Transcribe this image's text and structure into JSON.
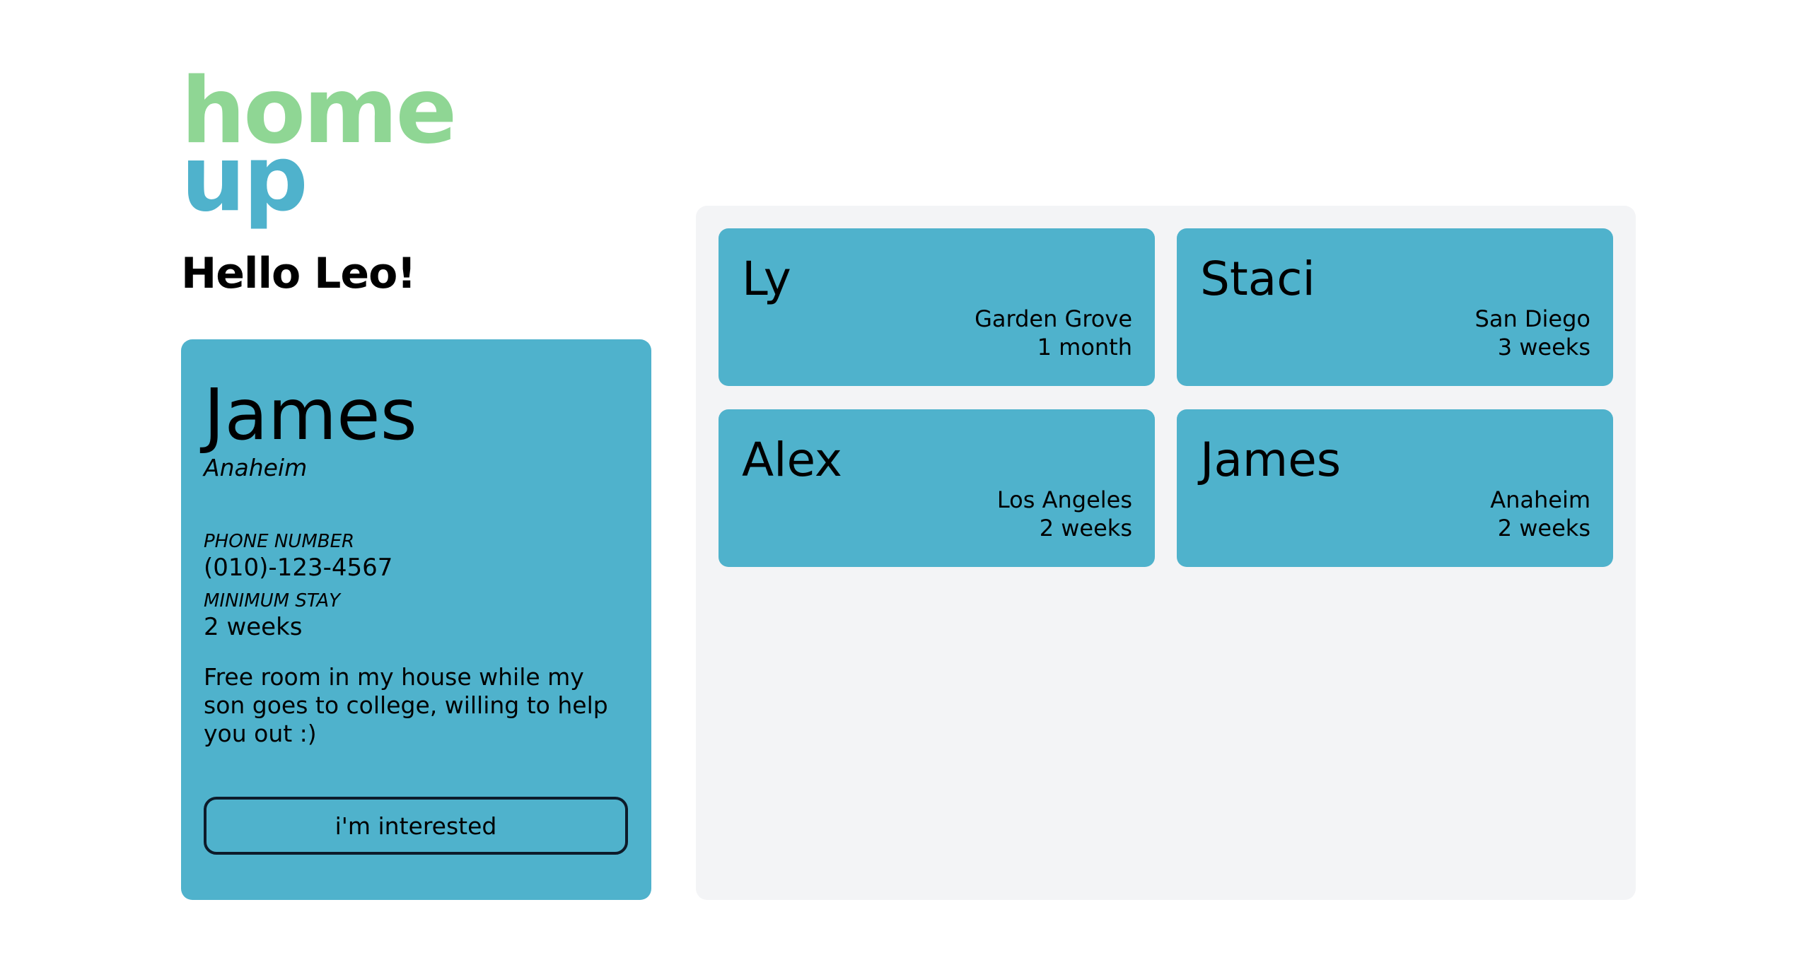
{
  "logo": {
    "line1": "home",
    "line2": "up"
  },
  "greeting": "Hello Leo!",
  "selected_listing": {
    "name": "James",
    "city": "Anaheim",
    "phone_label": "PHONE NUMBER",
    "phone": "(010)-123-4567",
    "min_stay_label": "MINIMUM STAY",
    "min_stay": "2 weeks",
    "description": "Free room in my house while my son goes to college, willing to help you out :)",
    "button_label": "i'm interested"
  },
  "listings": [
    {
      "name": "Ly",
      "city": "Garden Grove",
      "duration": "1 month"
    },
    {
      "name": "Staci",
      "city": "San Diego",
      "duration": "3 weeks"
    },
    {
      "name": "Alex",
      "city": "Los Angeles",
      "duration": "2 weeks"
    },
    {
      "name": "James",
      "city": "Anaheim",
      "duration": "2 weeks"
    }
  ],
  "colors": {
    "logo_home": "#8fd694",
    "logo_up": "#4fb2cc",
    "card_bg": "#4fb2cc",
    "panel_bg": "#f3f4f6"
  }
}
